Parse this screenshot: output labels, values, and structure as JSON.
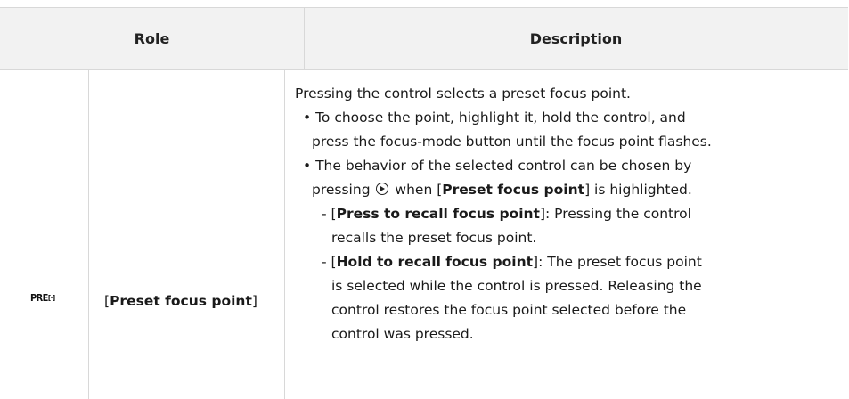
{
  "header": {
    "role": "Role",
    "description": "Description"
  },
  "row": {
    "icon_label": "PRE",
    "icon_symbol": "[·]",
    "role": {
      "open": "[",
      "name": "Preset focus point",
      "close": "]"
    },
    "description": {
      "line1": "Pressing the control selects a preset focus point.",
      "bullet1_a": "• To choose the point, highlight it, hold the control, and",
      "bullet1_b": "press the focus-mode button until the focus point flashes.",
      "bullet2_a": "• The behavior of the selected control can be chosen by",
      "bullet2_b_pre": "pressing",
      "bullet2_b_mid": "when [",
      "bullet2_b_bold": "Preset focus point",
      "bullet2_b_post": "] is highlighted.",
      "sub1_pre": "- [",
      "sub1_bold": "Press to recall focus point",
      "sub1_post": "]: Pressing the control",
      "sub1_b": "recalls the preset focus point.",
      "sub2_pre": "- [",
      "sub2_bold": "Hold to recall focus point",
      "sub2_post": "]: The preset focus point",
      "sub2_b": "is selected while the control is pressed. Releasing the",
      "sub2_c": "control restores the focus point selected before the",
      "sub2_d": "control was pressed."
    }
  }
}
